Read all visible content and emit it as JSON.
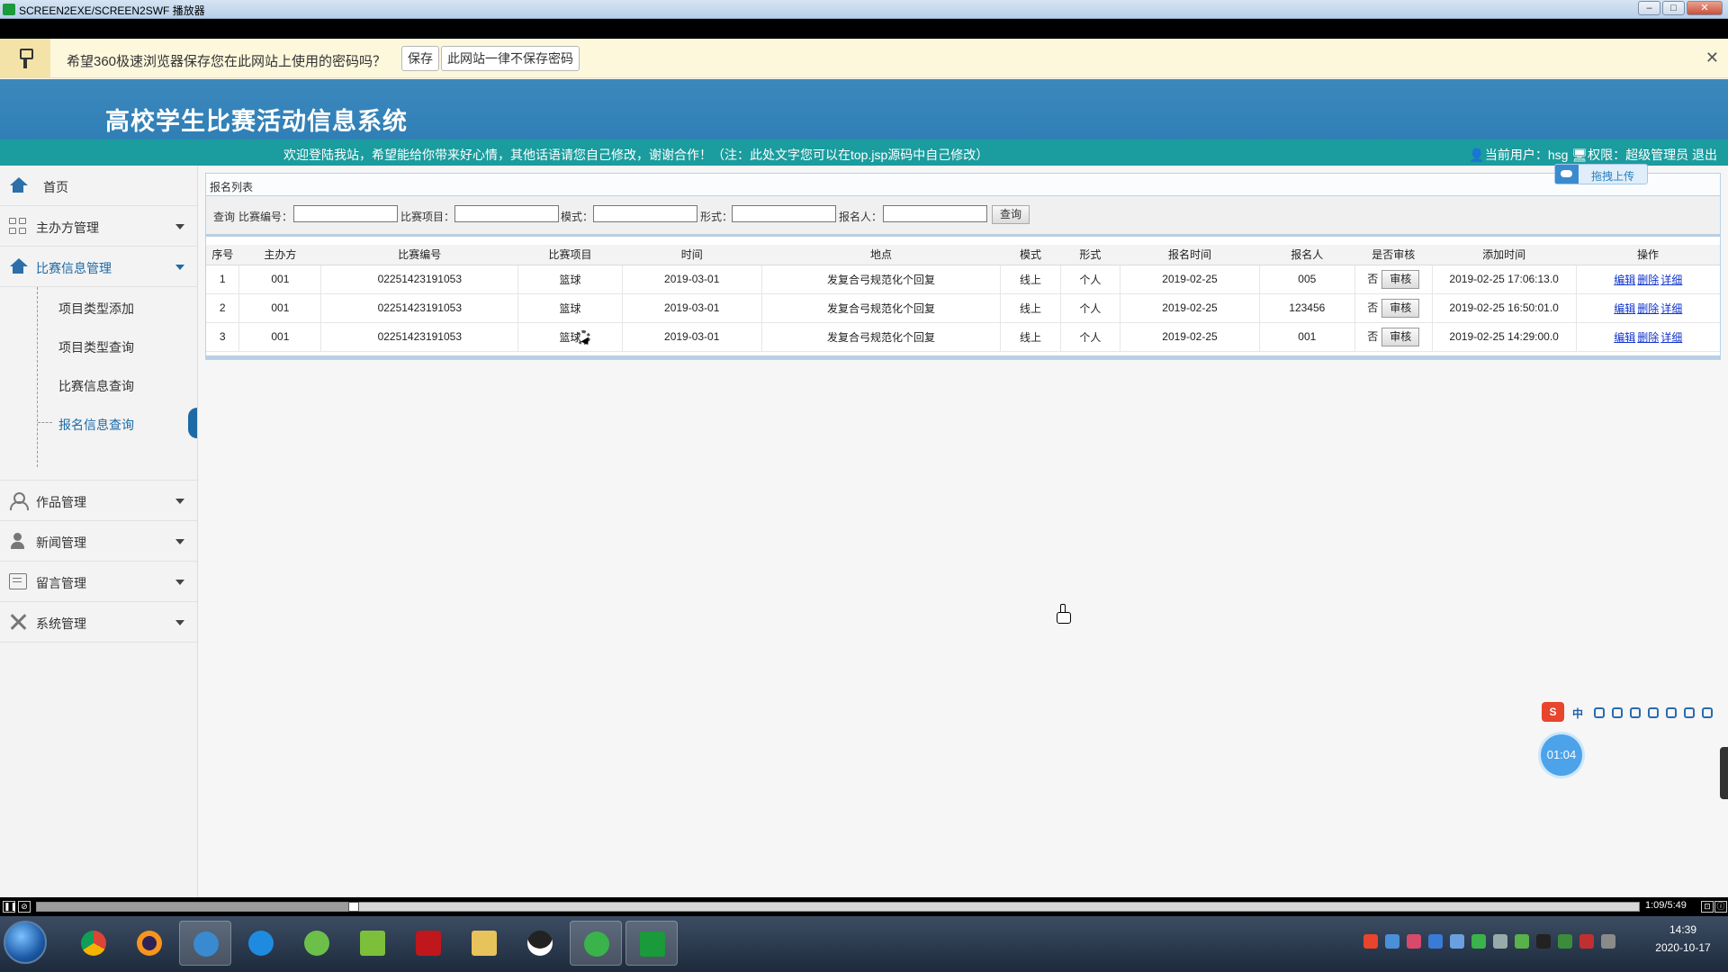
{
  "window": {
    "title": "SCREEN2EXE/SCREEN2SWF 播放器",
    "minimize": "–",
    "maximize": "□",
    "close": "✕"
  },
  "password_bar": {
    "message": "希望360极速浏览器保存您在此网站上使用的密码吗？",
    "save_label": "保存",
    "never_label": "此网站一律不保存密码",
    "close_label": "✕"
  },
  "header": {
    "system_title": "高校学生比赛活动信息系统",
    "welcome_text": "欢迎登陆我站，希望能给你带来好心情，其他话语请您自己修改，谢谢合作！（注：此处文字您可以在top.jsp源码中自己修改）",
    "user_text": "当前用户：hsg",
    "role_text": "权限：超级管理员",
    "logout_label": "退出"
  },
  "sidebar": {
    "home": "首页",
    "groups": [
      {
        "label": "主办方管理",
        "icon": "grid-icon"
      },
      {
        "label": "比赛信息管理",
        "icon": "home-icon"
      },
      {
        "label": "作品管理",
        "icon": "person-icon"
      },
      {
        "label": "新闻管理",
        "icon": "person-solid-icon"
      },
      {
        "label": "留言管理",
        "icon": "message-icon"
      },
      {
        "label": "系统管理",
        "icon": "tools-icon"
      }
    ],
    "sub_items": [
      "项目类型添加",
      "项目类型查询",
      "比赛信息查询",
      "报名信息查询"
    ]
  },
  "panel": {
    "title": "报名列表",
    "search": {
      "prefix": "查询",
      "labels": [
        "比赛编号：",
        "比赛项目：",
        "模式：",
        "形式：",
        "报名人："
      ],
      "button": "查询"
    },
    "columns": [
      "序号",
      "主办方",
      "比赛编号",
      "比赛项目",
      "时间",
      "地点",
      "模式",
      "形式",
      "报名时间",
      "报名人",
      "是否审核",
      "添加时间",
      "操作"
    ],
    "rows": [
      {
        "no": "1",
        "host": "001",
        "code": "02251423191053",
        "project": "篮球",
        "time": "2019-03-01",
        "place": "发复合弓规范化个回复",
        "mode": "线上",
        "form": "个人",
        "signup_time": "2019-02-25",
        "person": "005",
        "audited": "否",
        "added": "2019-02-25 17:06:13.0"
      },
      {
        "no": "2",
        "host": "001",
        "code": "02251423191053",
        "project": "篮球",
        "time": "2019-03-01",
        "place": "发复合弓规范化个回复",
        "mode": "线上",
        "form": "个人",
        "signup_time": "2019-02-25",
        "person": "123456",
        "audited": "否",
        "added": "2019-02-25 16:50:01.0"
      },
      {
        "no": "3",
        "host": "001",
        "code": "02251423191053",
        "project": "篮球",
        "time": "2019-03-01",
        "place": "发复合弓规范化个回复",
        "mode": "线上",
        "form": "个人",
        "signup_time": "2019-02-25",
        "person": "001",
        "audited": "否",
        "added": "2019-02-25 14:29:00.0"
      }
    ],
    "audit_label": "审核",
    "ops": [
      "编辑",
      "删除",
      "详细"
    ]
  },
  "upload_button": "拖拽上传",
  "ime": {
    "logo": "S",
    "mode": "中"
  },
  "timer": "01:04",
  "player": {
    "time": "1:09/5:49",
    "progress_fraction": 0.198
  },
  "clock": {
    "time": "14:39",
    "date": "2020-10-17"
  },
  "colors": {
    "header_blue": "#2f7fb6",
    "welcome_teal": "#1b9c9e",
    "active_blue": "#1d6aa5",
    "link_blue": "#1133cc"
  }
}
